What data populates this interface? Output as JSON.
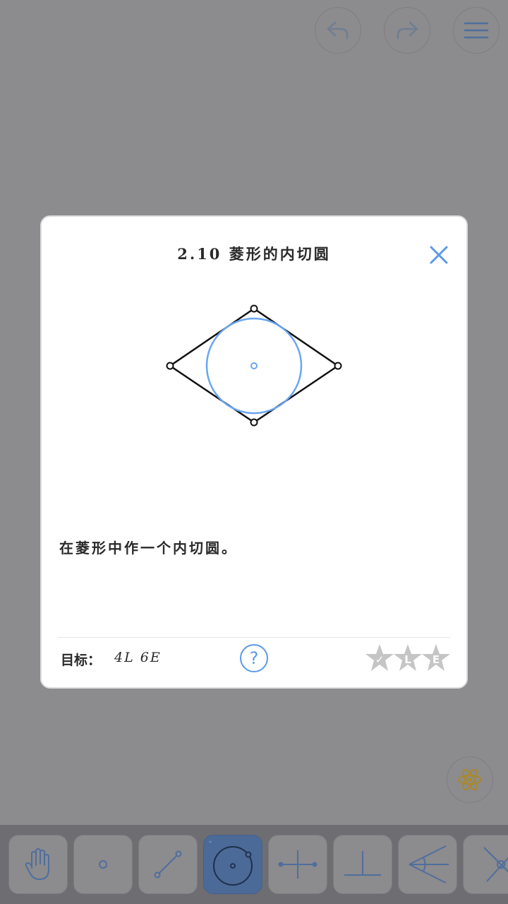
{
  "level": {
    "title": "2.10 菱形的内切圆",
    "task": "在菱形中作一个内切圆。",
    "goal_label": "目标：",
    "goal_value": "4L 6E",
    "star_marks": [
      "✓",
      "L",
      "E"
    ]
  },
  "help": {
    "label": "?"
  },
  "colors": {
    "accent": "#5a9ae8",
    "overlay_bg": "#8c8b8e",
    "active_tool": "#4b6a98",
    "circle": "#6aa6f0"
  },
  "top_buttons": [
    "undo-icon",
    "redo-icon",
    "menu-icon"
  ],
  "tools": [
    "hand-icon",
    "point-icon",
    "line-icon",
    "circle-icon",
    "perpendicular-bisector-icon",
    "perpendicular-icon",
    "angle-bisector-icon",
    "intersect-icon"
  ],
  "active_tool": "circle-icon"
}
